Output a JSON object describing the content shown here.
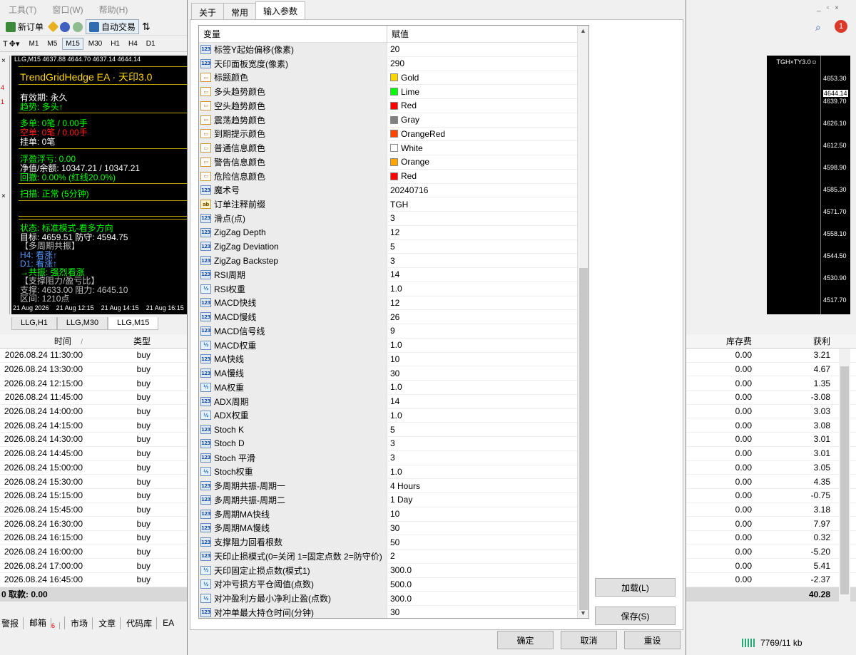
{
  "menu": [
    "工具(T)",
    "窗口(W)",
    "帮助(H)"
  ],
  "toolbar": {
    "new_order": "新订单",
    "auto_trade": "自动交易"
  },
  "timeframes": [
    "M1",
    "M5",
    "M15",
    "M30",
    "H1",
    "H4",
    "D1"
  ],
  "chart": {
    "header": "LLG,M15  4637.88 4644.70 4637.14 4644.14",
    "title": "TrendGridHedge EA · 天印3.0",
    "lines": [
      {
        "text": "有效期: 永久",
        "color": "#ffffff"
      },
      {
        "text": "趋势: 多头↑",
        "color": "#00ff00"
      },
      {
        "text": "多单: 0笔 / 0.00手",
        "color": "#00ff00"
      },
      {
        "text": "空单: 0笔 / 0.00手",
        "color": "#ff2020"
      },
      {
        "text": "挂单: 0笔",
        "color": "#ffffff"
      },
      {
        "text": "浮盈浮亏: 0.00",
        "color": "#00ff00"
      },
      {
        "text": "净值/余额: 10347.21 / 10347.21",
        "color": "#ffffff"
      },
      {
        "text": "回撤: 0.00% (红线20.0%)",
        "color": "#00ff00"
      },
      {
        "text": "扫描: 正常 (5分钟)",
        "color": "#00ff00"
      },
      {
        "text": "状态: 标准模式-看多方向",
        "color": "#00ff00"
      },
      {
        "text": "目标: 4659.51  防守: 4594.75",
        "color": "#ffffff"
      },
      {
        "text": "【多周期共振】",
        "color": "#c0c0c0"
      },
      {
        "text": "H4: 看涨↑",
        "color": "#5599ff"
      },
      {
        "text": "D1: 看涨↑",
        "color": "#5599ff"
      },
      {
        "text": "→共振: 强烈看涨",
        "color": "#00ff00"
      },
      {
        "text": "【支撑阻力/盈亏比】",
        "color": "#c0c0c0"
      },
      {
        "text": "支撑: 4633.00  阻力: 4645.10",
        "color": "#c0c0c0"
      },
      {
        "text": "区间: 1210点",
        "color": "#c0c0c0"
      }
    ],
    "time_labels": [
      "21 Aug 2026",
      "21 Aug 12:15",
      "21 Aug 14:15",
      "21 Aug 16:15"
    ],
    "corner_label": "TGH×TY3.0☺",
    "price_labels": [
      "4653.30",
      "4644.14",
      "4639.70",
      "4626.10",
      "4612.50",
      "4598.90",
      "4585.30",
      "4571.70",
      "4558.10",
      "4544.50",
      "4530.90",
      "4517.70"
    ],
    "tabs": [
      "LLG,H1",
      "LLG,M30",
      "LLG,M15"
    ]
  },
  "orders": {
    "col_time": "时间",
    "col_sort": "/",
    "col_type": "类型",
    "col_swap": "库存费",
    "col_profit": "获利",
    "rows": [
      {
        "time": "2026.08.24 11:30:00",
        "type": "buy",
        "swap": "0.00",
        "profit": "3.21"
      },
      {
        "time": "2026.08.24 13:30:00",
        "type": "buy",
        "swap": "0.00",
        "profit": "4.67"
      },
      {
        "time": "2026.08.24 12:15:00",
        "type": "buy",
        "swap": "0.00",
        "profit": "1.35"
      },
      {
        "time": "2026.08.24 11:45:00",
        "type": "buy",
        "swap": "0.00",
        "profit": "-3.08"
      },
      {
        "time": "2026.08.24 14:00:00",
        "type": "buy",
        "swap": "0.00",
        "profit": "3.03"
      },
      {
        "time": "2026.08.24 14:15:00",
        "type": "buy",
        "swap": "0.00",
        "profit": "3.08"
      },
      {
        "time": "2026.08.24 14:30:00",
        "type": "buy",
        "swap": "0.00",
        "profit": "3.01"
      },
      {
        "time": "2026.08.24 14:45:00",
        "type": "buy",
        "swap": "0.00",
        "profit": "3.01"
      },
      {
        "time": "2026.08.24 15:00:00",
        "type": "buy",
        "swap": "0.00",
        "profit": "3.05"
      },
      {
        "time": "2026.08.24 15:30:00",
        "type": "buy",
        "swap": "0.00",
        "profit": "4.35"
      },
      {
        "time": "2026.08.24 15:15:00",
        "type": "buy",
        "swap": "0.00",
        "profit": "-0.75"
      },
      {
        "time": "2026.08.24 15:45:00",
        "type": "buy",
        "swap": "0.00",
        "profit": "3.18"
      },
      {
        "time": "2026.08.24 16:30:00",
        "type": "buy",
        "swap": "0.00",
        "profit": "7.97"
      },
      {
        "time": "2026.08.24 16:15:00",
        "type": "buy",
        "swap": "0.00",
        "profit": "0.32"
      },
      {
        "time": "2026.08.24 16:00:00",
        "type": "buy",
        "swap": "0.00",
        "profit": "-5.20"
      },
      {
        "time": "2026.08.24 17:00:00",
        "type": "buy",
        "swap": "0.00",
        "profit": "5.41"
      },
      {
        "time": "2026.08.24 16:45:00",
        "type": "buy",
        "swap": "0.00",
        "profit": "-2.37"
      }
    ],
    "balance_label": "0  取款: 0.00",
    "total_profit": "40.28"
  },
  "bottom_tabs": [
    "警报",
    "邮箱",
    "市场",
    "文章",
    "代码库",
    "EA"
  ],
  "mail_count": "6",
  "status": {
    "traffic": "7769/11 kb"
  },
  "notify_count": "1",
  "dialog": {
    "tabs": [
      "关于",
      "常用",
      "输入参数"
    ],
    "col_var": "变量",
    "col_val": "赋值",
    "params": [
      {
        "icon": "123",
        "name": "标签Y起始偏移(像素)",
        "value": "20"
      },
      {
        "icon": "123",
        "name": "天印面板宽度(像素)",
        "value": "290"
      },
      {
        "icon": "color",
        "name": "标题颜色",
        "value": "Gold",
        "swatch": "#ffd700"
      },
      {
        "icon": "color",
        "name": "多头趋势颜色",
        "value": "Lime",
        "swatch": "#00ff00"
      },
      {
        "icon": "color",
        "name": "空头趋势颜色",
        "value": "Red",
        "swatch": "#ff0000"
      },
      {
        "icon": "color",
        "name": "震荡趋势颜色",
        "value": "Gray",
        "swatch": "#808080"
      },
      {
        "icon": "color",
        "name": "到期提示颜色",
        "value": "OrangeRed",
        "swatch": "#ff4500"
      },
      {
        "icon": "color",
        "name": "普通信息颜色",
        "value": "White",
        "swatch": "#ffffff"
      },
      {
        "icon": "color",
        "name": "警告信息颜色",
        "value": "Orange",
        "swatch": "#ffa500"
      },
      {
        "icon": "color",
        "name": "危险信息颜色",
        "value": "Red",
        "swatch": "#ff0000"
      },
      {
        "icon": "123",
        "name": "魔术号",
        "value": "20240716"
      },
      {
        "icon": "ab",
        "name": "订单注释前缀",
        "value": "TGH"
      },
      {
        "icon": "123",
        "name": "滑点(点)",
        "value": "3"
      },
      {
        "icon": "123",
        "name": "ZigZag Depth",
        "value": "12"
      },
      {
        "icon": "123",
        "name": "ZigZag Deviation",
        "value": "5"
      },
      {
        "icon": "123",
        "name": "ZigZag Backstep",
        "value": "3"
      },
      {
        "icon": "123",
        "name": "RSI周期",
        "value": "14"
      },
      {
        "icon": "v2",
        "name": "RSI权重",
        "value": "1.0"
      },
      {
        "icon": "123",
        "name": "MACD快线",
        "value": "12"
      },
      {
        "icon": "123",
        "name": "MACD慢线",
        "value": "26"
      },
      {
        "icon": "123",
        "name": "MACD信号线",
        "value": "9"
      },
      {
        "icon": "v2",
        "name": "MACD权重",
        "value": "1.0"
      },
      {
        "icon": "123",
        "name": "MA快线",
        "value": "10"
      },
      {
        "icon": "123",
        "name": "MA慢线",
        "value": "30"
      },
      {
        "icon": "v2",
        "name": "MA权重",
        "value": "1.0"
      },
      {
        "icon": "123",
        "name": "ADX周期",
        "value": "14"
      },
      {
        "icon": "v2",
        "name": "ADX权重",
        "value": "1.0"
      },
      {
        "icon": "123",
        "name": "Stoch K",
        "value": "5"
      },
      {
        "icon": "123",
        "name": "Stoch D",
        "value": "3"
      },
      {
        "icon": "123",
        "name": "Stoch 平滑",
        "value": "3"
      },
      {
        "icon": "v2",
        "name": "Stoch权重",
        "value": "1.0"
      },
      {
        "icon": "123",
        "name": "多周期共振-周期一",
        "value": "4 Hours"
      },
      {
        "icon": "123",
        "name": "多周期共振-周期二",
        "value": "1 Day"
      },
      {
        "icon": "123",
        "name": "多周期MA快线",
        "value": "10"
      },
      {
        "icon": "123",
        "name": "多周期MA慢线",
        "value": "30"
      },
      {
        "icon": "123",
        "name": "支撑阻力回看根数",
        "value": "50"
      },
      {
        "icon": "123",
        "name": "天印止损模式(0=关闭 1=固定点数 2=防守价)",
        "value": "2"
      },
      {
        "icon": "v2",
        "name": "天印固定止损点数(模式1)",
        "value": "300.0"
      },
      {
        "icon": "v2",
        "name": "对冲亏损方平仓阈值(点数)",
        "value": "500.0"
      },
      {
        "icon": "v2",
        "name": "对冲盈利方最小净利止盈(点数)",
        "value": "300.0"
      },
      {
        "icon": "123",
        "name": "对冲单最大持仓时间(分钟)",
        "value": "30"
      }
    ],
    "load_button": "加载(L)",
    "save_button": "保存(S)",
    "ok_button": "确定",
    "cancel_button": "取消",
    "reset_button": "重设"
  }
}
